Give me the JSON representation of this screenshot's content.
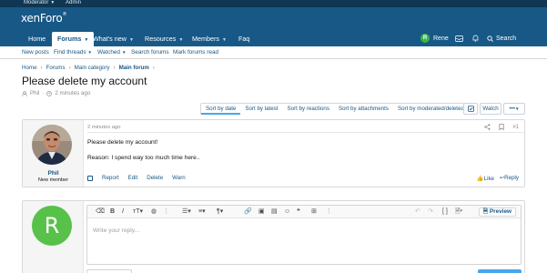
{
  "staff_bar": {
    "moderator": "Moderator",
    "admin": "Admin"
  },
  "header": {
    "logo_text": "xenForo",
    "logo_mark": "®"
  },
  "nav": {
    "tabs": [
      {
        "label": "Home"
      },
      {
        "label": "Forums"
      },
      {
        "label": "What's new"
      },
      {
        "label": "Resources"
      },
      {
        "label": "Members"
      },
      {
        "label": "Faq"
      }
    ],
    "user_initial": "R",
    "user_name": "Rene",
    "search_label": "Search"
  },
  "subnav": {
    "items": [
      "New posts",
      "Find threads",
      "Watched",
      "Search forums",
      "Mark forums read"
    ]
  },
  "breadcrumb": [
    "Home",
    "Forums",
    "Main category",
    "Main forum"
  ],
  "thread": {
    "title": "Please delete my account",
    "author": "Phil",
    "time": "2 minutes ago"
  },
  "sort_tabs": [
    "Sort by date",
    "Sort by latest",
    "Sort by reactions",
    "Sort by attachments",
    "Sort by moderated/deleted"
  ],
  "tools": {
    "watch": "Watch",
    "more": "•••"
  },
  "post": {
    "username": "Phil",
    "user_title": "New member",
    "date": "2 minutes ago",
    "number": "#1",
    "lines": [
      "Please delete my account!",
      "Reason: I spend way too much time here.."
    ],
    "actions": [
      "Report",
      "Edit",
      "Delete",
      "Warn"
    ],
    "like": "Like",
    "reply": "Reply"
  },
  "reply_box": {
    "avatar_initial": "R",
    "placeholder": "Write your reply...",
    "preview": "Preview"
  },
  "colors": {
    "staff_bar": "#0f3652",
    "header": "#185886",
    "link": "#185886",
    "accent": "#47a7eb",
    "avatar_green": "#57c14a"
  }
}
